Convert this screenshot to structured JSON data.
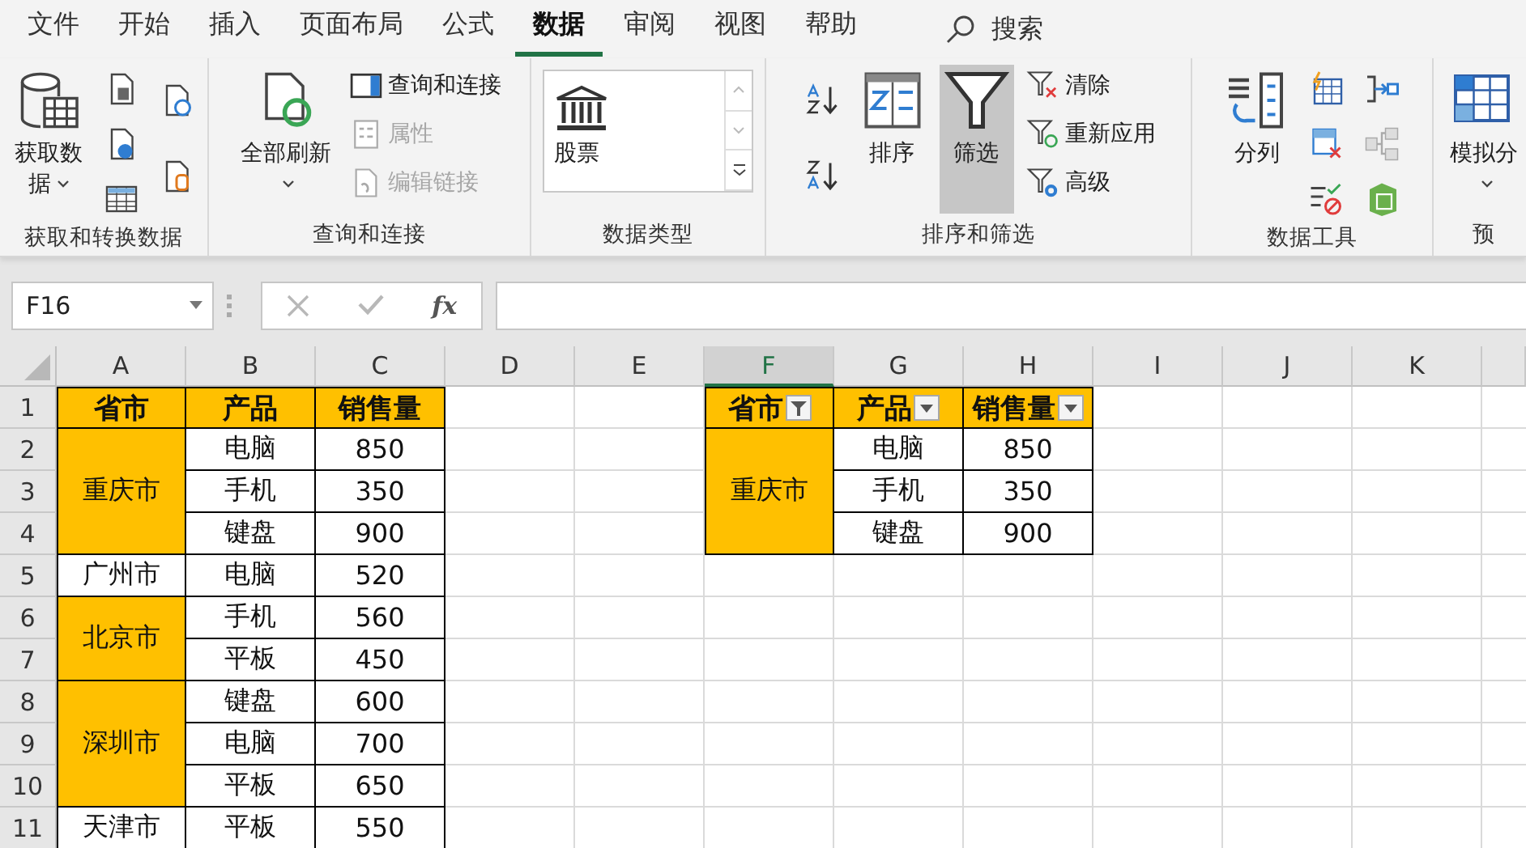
{
  "menu_tabs": [
    {
      "label": "文件",
      "selected": false
    },
    {
      "label": "开始",
      "selected": false
    },
    {
      "label": "插入",
      "selected": false
    },
    {
      "label": "页面布局",
      "selected": false
    },
    {
      "label": "公式",
      "selected": false
    },
    {
      "label": "数据",
      "selected": true
    },
    {
      "label": "审阅",
      "selected": false
    },
    {
      "label": "视图",
      "selected": false
    },
    {
      "label": "帮助",
      "selected": false
    }
  ],
  "search": {
    "label": "搜索"
  },
  "ribbon_groups": [
    {
      "label": "获取和转换数据",
      "columns": [
        [
          {
            "kind": "large",
            "label": "获取数据",
            "menu": true,
            "pressed": false
          }
        ],
        [
          {
            "kind": "icon"
          },
          {
            "kind": "icon"
          },
          {
            "kind": "icon"
          }
        ],
        [
          {
            "kind": "icon"
          },
          {
            "kind": "icon"
          }
        ]
      ]
    },
    {
      "label": "查询和连接",
      "columns": [
        [
          {
            "kind": "large",
            "label": "全部刷新",
            "menu": true,
            "pressed": false
          }
        ],
        [
          {
            "kind": "small",
            "label": "查询和连接",
            "disabled": false
          },
          {
            "kind": "small",
            "label": "属性",
            "disabled": true
          },
          {
            "kind": "small",
            "label": "编辑链接",
            "disabled": true
          }
        ]
      ]
    },
    {
      "label": "数据类型",
      "columns": [
        [
          {
            "kind": "gallery",
            "label": "股票"
          }
        ]
      ]
    },
    {
      "label": "排序和筛选",
      "columns": [
        [
          {
            "kind": "icon"
          },
          {
            "kind": "icon"
          }
        ],
        [
          {
            "kind": "large",
            "label": "排序",
            "menu": false,
            "pressed": false
          }
        ],
        [
          {
            "kind": "large",
            "label": "筛选",
            "menu": false,
            "pressed": true
          }
        ],
        [
          {
            "kind": "small",
            "label": "清除",
            "disabled": false
          },
          {
            "kind": "small",
            "label": "重新应用",
            "disabled": false
          },
          {
            "kind": "small",
            "label": "高级",
            "disabled": false
          }
        ]
      ]
    },
    {
      "label": "数据工具",
      "columns": [
        [
          {
            "kind": "large",
            "label": "分列",
            "menu": false,
            "pressed": false
          }
        ],
        [
          {
            "kind": "icon"
          },
          {
            "kind": "icon"
          },
          {
            "kind": "icon"
          }
        ],
        [
          {
            "kind": "icon"
          },
          {
            "kind": "icon"
          },
          {
            "kind": "icon"
          }
        ]
      ]
    },
    {
      "label": "预",
      "columns": [
        [
          {
            "kind": "large",
            "label": "模拟分",
            "menu": true,
            "pressed": false
          }
        ]
      ]
    }
  ],
  "formula_bar": {
    "name_box": "F16",
    "function_label": "fx"
  },
  "sheet": {
    "columns": [
      {
        "label": "A",
        "selected": false
      },
      {
        "label": "B",
        "selected": false
      },
      {
        "label": "C",
        "selected": false
      },
      {
        "label": "D",
        "selected": false
      },
      {
        "label": "E",
        "selected": false
      },
      {
        "label": "F",
        "selected": true
      },
      {
        "label": "G",
        "selected": false
      },
      {
        "label": "H",
        "selected": false
      },
      {
        "label": "I",
        "selected": false
      },
      {
        "label": "J",
        "selected": false
      },
      {
        "label": "K",
        "selected": false
      }
    ],
    "rows": [
      "1",
      "2",
      "3",
      "4",
      "5",
      "6",
      "7",
      "8",
      "9",
      "10",
      "11"
    ],
    "tables": [
      {
        "autofilter": false,
        "headers": [
          {
            "label": "省市"
          },
          {
            "label": "产品"
          },
          {
            "label": "销售量"
          }
        ],
        "groups": [
          {
            "label": "重庆市",
            "filled": true,
            "rows": [
              {
                "product": "电脑",
                "sales": "850"
              },
              {
                "product": "手机",
                "sales": "350"
              },
              {
                "product": "键盘",
                "sales": "900"
              }
            ]
          },
          {
            "label": "广州市",
            "filled": false,
            "rows": [
              {
                "product": "电脑",
                "sales": "520"
              }
            ]
          },
          {
            "label": "北京市",
            "filled": true,
            "rows": [
              {
                "product": "手机",
                "sales": "560"
              },
              {
                "product": "平板",
                "sales": "450"
              }
            ]
          },
          {
            "label": "深圳市",
            "filled": true,
            "rows": [
              {
                "product": "键盘",
                "sales": "600"
              },
              {
                "product": "电脑",
                "sales": "700"
              },
              {
                "product": "平板",
                "sales": "650"
              }
            ]
          },
          {
            "label": "天津市",
            "filled": false,
            "rows": [
              {
                "product": "平板",
                "sales": "550"
              }
            ]
          }
        ]
      },
      {
        "autofilter": true,
        "headers": [
          {
            "label": "省市",
            "filtered": true
          },
          {
            "label": "产品",
            "filtered": false
          },
          {
            "label": "销售量",
            "filtered": false
          }
        ],
        "groups": [
          {
            "label": "重庆市",
            "filled": true,
            "rows": [
              {
                "product": "电脑",
                "sales": "850"
              },
              {
                "product": "手机",
                "sales": "350"
              },
              {
                "product": "键盘",
                "sales": "900"
              }
            ]
          }
        ]
      }
    ]
  }
}
